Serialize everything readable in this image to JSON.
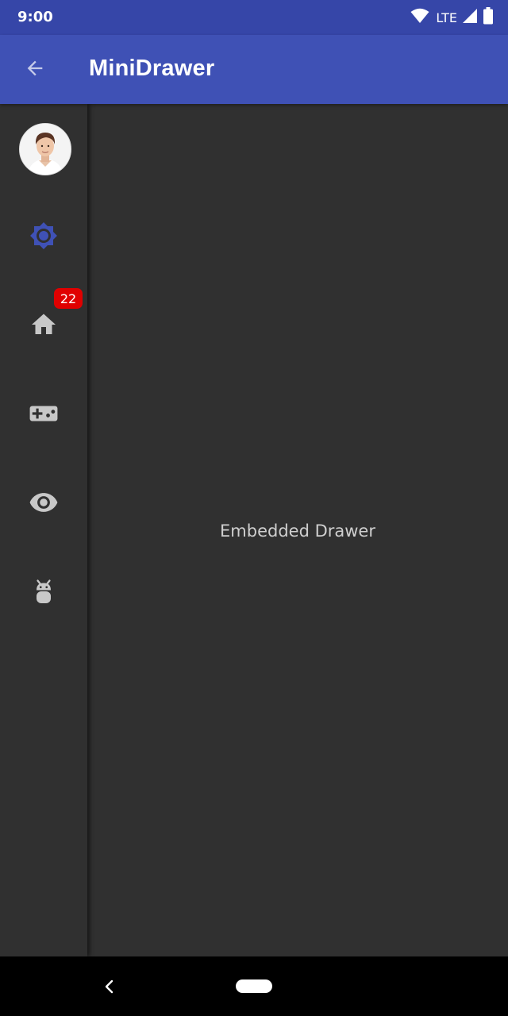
{
  "status_bar": {
    "time": "9:00",
    "network_label": "LTE",
    "icons": [
      "wifi-icon",
      "signal-icon",
      "battery-icon"
    ]
  },
  "app_bar": {
    "title": "MiniDrawer",
    "back_icon": "arrow-back-icon"
  },
  "drawer": {
    "items": [
      {
        "icon": "brightness-icon",
        "selected": true
      },
      {
        "icon": "home-icon",
        "badge": "22"
      },
      {
        "icon": "gamepad-icon"
      },
      {
        "icon": "eye-icon"
      },
      {
        "icon": "android-icon"
      }
    ]
  },
  "content": {
    "text": "Embedded Drawer"
  },
  "colors": {
    "primary": "#3f51b5",
    "primary_dark": "#3646a8",
    "background": "#303030",
    "icon": "#c8c8c8",
    "badge": "#e00000"
  }
}
